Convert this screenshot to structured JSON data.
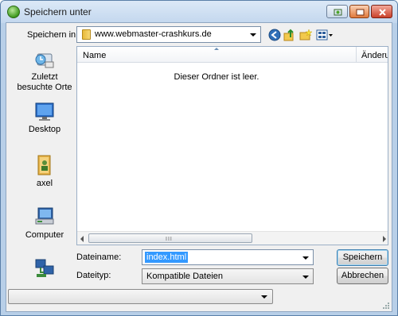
{
  "window": {
    "title": "Speichern unter"
  },
  "toolbar": {
    "save_in_label": "Speichern in:",
    "save_in_value": "www.webmaster-crashkurs.de"
  },
  "places": [
    {
      "label": "Zuletzt besuchte Orte",
      "icon": "recent-places-icon"
    },
    {
      "label": "Desktop",
      "icon": "desktop-icon"
    },
    {
      "label": "axel",
      "icon": "user-folder-icon"
    },
    {
      "label": "Computer",
      "icon": "computer-icon"
    },
    {
      "label": "",
      "icon": "network-icon"
    }
  ],
  "filelist": {
    "col_name": "Name",
    "col_changed": "Änderun",
    "empty_message": "Dieser Ordner ist leer."
  },
  "form": {
    "filename_label": "Dateiname:",
    "filename_value": "index.html",
    "filetype_label": "Dateityp:",
    "filetype_value": "Kompatible Dateien",
    "save_button": "Speichern",
    "cancel_button": "Abbrechen"
  },
  "colors": {
    "selection": "#3399ff",
    "title_bg": "#c3d7ee"
  }
}
